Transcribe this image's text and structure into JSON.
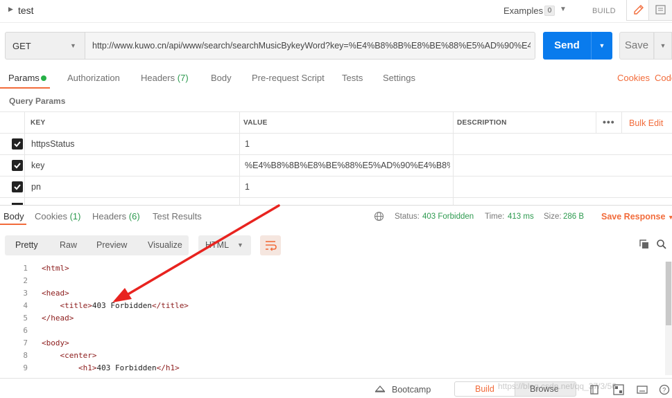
{
  "request": {
    "name": "test",
    "examples_label": "Examples",
    "examples_count": "0",
    "build_label": "BUILD"
  },
  "url_bar": {
    "method": "GET",
    "url": "http://www.kuwo.cn/api/www/search/searchMusicBykeyWord?key=%E4%B8%8B%E8%BE%88%E5%AD%90%E4 ...",
    "send_label": "Send",
    "save_label": "Save"
  },
  "request_tabs": {
    "params": "Params",
    "authorization": "Authorization",
    "headers": "Headers",
    "headers_count": "(7)",
    "body": "Body",
    "prerequest": "Pre-request Script",
    "tests": "Tests",
    "settings": "Settings",
    "cookies": "Cookies",
    "code": "Code"
  },
  "query_params": {
    "title": "Query Params",
    "columns": {
      "key": "KEY",
      "value": "VALUE",
      "description": "DESCRIPTION"
    },
    "bulk_edit": "Bulk Edit",
    "more": "•••",
    "rows": [
      {
        "key": "httpsStatus",
        "value": "1",
        "checked": true
      },
      {
        "key": "key",
        "value": "%E4%B8%8B%E8%BE%88%E5%AD%90%E4%B8%8...",
        "checked": true
      },
      {
        "key": "pn",
        "value": "1",
        "checked": true
      }
    ]
  },
  "response_tabs": {
    "body": "Body",
    "cookies": "Cookies",
    "cookies_count": "(1)",
    "headers": "Headers",
    "headers_count": "(6)",
    "test_results": "Test Results"
  },
  "response_meta": {
    "status_label": "Status:",
    "status_value": "403 Forbidden",
    "time_label": "Time:",
    "time_value": "413 ms",
    "size_label": "Size:",
    "size_value": "286 B",
    "save_response": "Save Response"
  },
  "view_modes": {
    "pretty": "Pretty",
    "raw": "Raw",
    "preview": "Preview",
    "visualize": "Visualize",
    "format": "HTML"
  },
  "code_lines": [
    {
      "n": "1",
      "text": "<html>"
    },
    {
      "n": "2",
      "text": ""
    },
    {
      "n": "3",
      "text": "<head>"
    },
    {
      "n": "4",
      "text": "    <title>403 Forbidden</title>"
    },
    {
      "n": "5",
      "text": "</head>"
    },
    {
      "n": "6",
      "text": ""
    },
    {
      "n": "7",
      "text": "<body>"
    },
    {
      "n": "8",
      "text": "    <center>"
    },
    {
      "n": "9",
      "text": "        <h1>403 Forbidden</h1>"
    }
  ],
  "status_bar": {
    "bootcamp": "Bootcamp",
    "build": "Build",
    "browse": "Browse",
    "watermark": "https://blog.csdn.net/qq_37/3/56"
  },
  "colors": {
    "accent": "#f26b3a",
    "send_blue": "#097bed",
    "success_green": "#2d9a4f",
    "annotation_red": "#e8231f"
  }
}
